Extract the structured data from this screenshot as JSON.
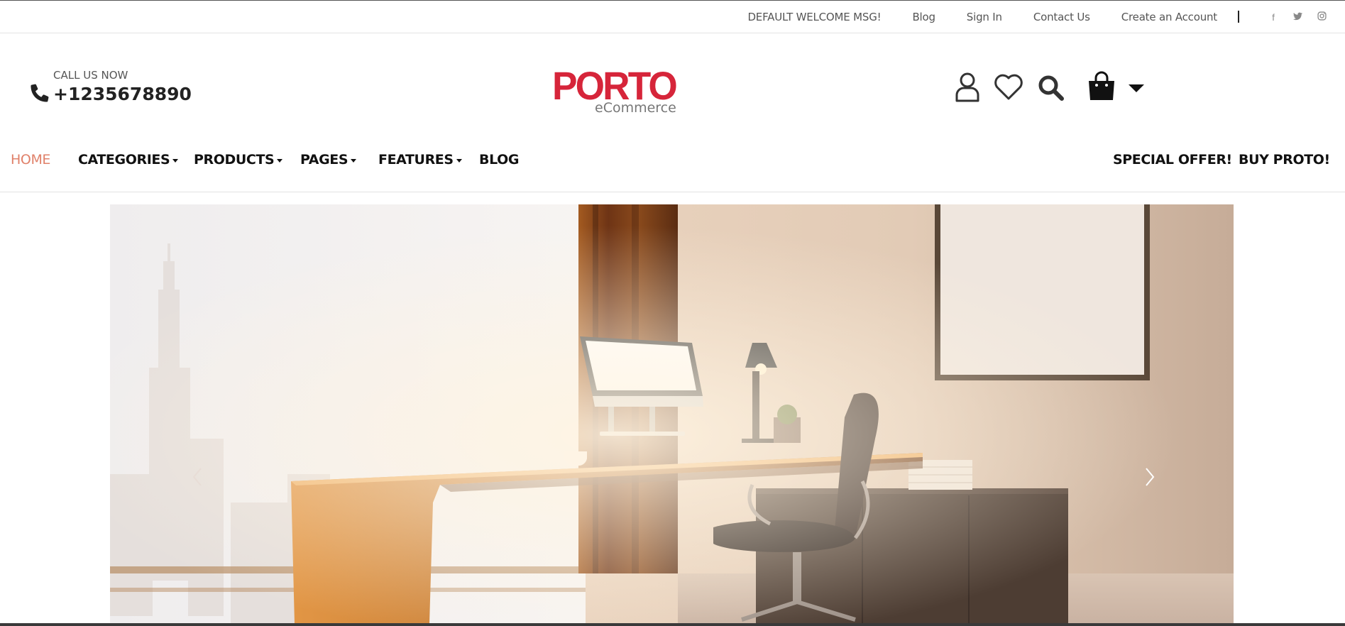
{
  "topbar": {
    "welcome": "DEFAULT WELCOME MSG!",
    "links": [
      "Blog",
      "Sign In",
      "Contact Us",
      "Create an Account"
    ],
    "social": [
      {
        "name": "facebook-icon",
        "glyph": "f"
      },
      {
        "name": "twitter-icon",
        "glyph": "t"
      },
      {
        "name": "instagram-icon",
        "glyph": "◎"
      }
    ]
  },
  "header": {
    "call_label": "CALL US NOW",
    "call_number": "+1235678890",
    "logo_word": "PORTO",
    "logo_sub": "eCommerce",
    "icons": [
      "user-icon",
      "heart-icon",
      "search-icon",
      "cart-icon",
      "caret-down-icon"
    ],
    "brand_color": "#d6253a"
  },
  "nav": {
    "items": [
      {
        "label": "HOME",
        "active": true,
        "dropdown": false
      },
      {
        "label": "CATEGORIES",
        "active": false,
        "dropdown": true
      },
      {
        "label": "PRODUCTS",
        "active": false,
        "dropdown": true
      },
      {
        "label": "PAGES",
        "active": false,
        "dropdown": true
      },
      {
        "label": "FEATURES",
        "active": false,
        "dropdown": true
      },
      {
        "label": "BLOG",
        "active": false,
        "dropdown": false
      }
    ],
    "right": [
      "SPECIAL OFFER!",
      "BUY PROTO!"
    ],
    "active_color": "#e0816a"
  },
  "slider": {
    "arrows": [
      "chevron-left-icon",
      "chevron-right-icon"
    ]
  }
}
